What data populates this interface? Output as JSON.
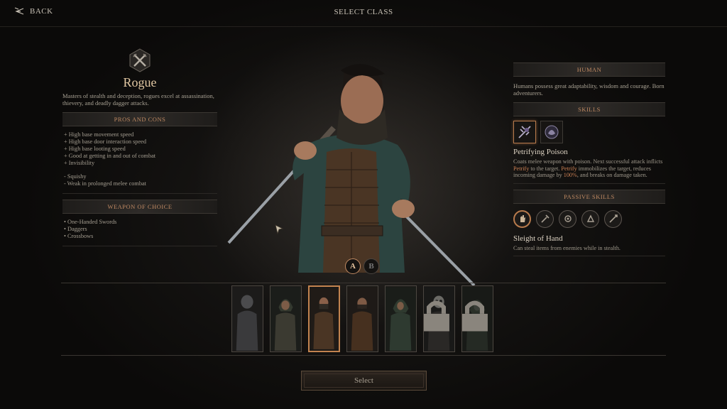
{
  "topbar": {
    "back_label": "BACK",
    "title": "SELECT CLASS"
  },
  "class": {
    "name": "Rogue",
    "description": "Masters of stealth and deception, rogues excel at assassination, thievery, and deadly dagger attacks.",
    "pros_cons_header": "PROS AND CONS",
    "pros": [
      "+ High base movement speed",
      "+ High base door interaction speed",
      "+ High base looting speed",
      "+ Good at getting in and out of combat",
      "+ Invisibility"
    ],
    "cons": [
      "- Squishy",
      "- Weak in prolonged melee combat"
    ],
    "weapon_header": "WEAPON OF CHOICE",
    "weapons": [
      "• One-Handed Swords",
      "• Daggers",
      "• Crossbows"
    ]
  },
  "race": {
    "header": "HUMAN",
    "description": "Humans possess great adaptability, wisdom and courage. Born adventurers."
  },
  "skills": {
    "header": "SKILLS",
    "icons": [
      "poison-skill-icon",
      "stealth-skill-icon"
    ],
    "selected_title": "Petrifying Poison",
    "desc_part1": "Coats melee weapon with poison. Next successful attack inflicts ",
    "desc_hl1": "Petrify",
    "desc_part2": " to the target. ",
    "desc_hl2": "Petrify",
    "desc_part3": " immobilizes the target, reduces incoming damage by ",
    "desc_hl3": "100%",
    "desc_part4": ", and breaks on damage taken."
  },
  "passive": {
    "header": "PASSIVE SKILLS",
    "icons": [
      "sleight-of-hand-icon",
      "lockpick-icon",
      "poison-weapon-icon",
      "ambush-icon",
      "backstab-icon"
    ],
    "selected_title": "Sleight of Hand",
    "selected_desc": "Can steal items from enemies while in stealth."
  },
  "outfit": {
    "a_label": "A",
    "b_label": "B",
    "selected": "A"
  },
  "variants": {
    "count": 7,
    "selected_index": 2,
    "locked": [
      5,
      6
    ]
  },
  "select_label": "Select",
  "colors": {
    "accent": "#c08a63",
    "highlight": "#c97f53",
    "bg": "#0d0c0b"
  }
}
